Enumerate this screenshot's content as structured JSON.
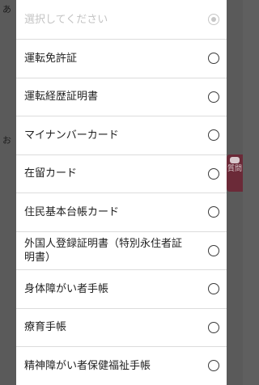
{
  "dialog": {
    "placeholder": "選択してください",
    "options": [
      "運転免許証",
      "運転経歴証明書",
      "マイナンバーカード",
      "在留カード",
      "住民基本台帳カード",
      "外国人登録証明書（特別永住者証明書）",
      "身体障がい者手帳",
      "療育手帳",
      "精神障がい者保健福祉手帳"
    ],
    "selected_index": -1
  },
  "background": {
    "side_tab_label": "質問",
    "side_tab_icon": "chat-bubble-icon",
    "side_tab_color": "#6b2a38",
    "overlay_color": "#5a5a5a"
  }
}
